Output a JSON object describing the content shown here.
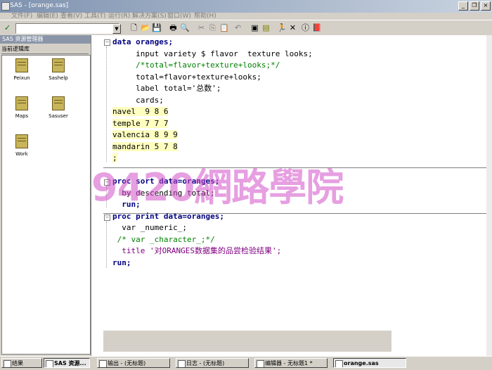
{
  "window": {
    "title": "SAS - [orange.sas]"
  },
  "menu": [
    "文件(F)",
    "编辑(E)",
    "查看(V)",
    "工具(T)",
    "运行(R)",
    "解决方案(S)",
    "窗口(W)",
    "帮助(H)"
  ],
  "command_box": {
    "value": ""
  },
  "explorer": {
    "header": "SAS 资源管理器",
    "subheader": "当前逻辑库",
    "libraries": [
      "Peixun",
      "Sashelp",
      "Maps",
      "Sasuser",
      "Work"
    ]
  },
  "code_lines": [
    "data oranges;",
    "     input variety $ flavor  texture looks;",
    "     /*total=flavor+texture+looks;*/",
    "     total=flavor+texture+looks;",
    "     label total='总数';",
    "     cards;",
    "navel  9 8 6",
    "temple 7 7 7",
    "valencia 8 9 9",
    "mandarin 5 7 8",
    ";",
    "",
    "proc sort data=oranges;",
    "  by descending total;",
    "  run;",
    "proc print data=oranges;",
    "  var _numeric_;",
    " /* var _character_;*/",
    "  title '对ORANGES数据集的品尝检验结果';",
    "run;"
  ],
  "watermark": "9420網路學院",
  "taskbar": {
    "left_tabs": [
      "结果",
      "SAS 资源..."
    ],
    "windows": [
      "输出 - (无标题)",
      "日志 - (无标题)",
      "编辑器 - 无标题1 *",
      "orange.sas"
    ]
  }
}
